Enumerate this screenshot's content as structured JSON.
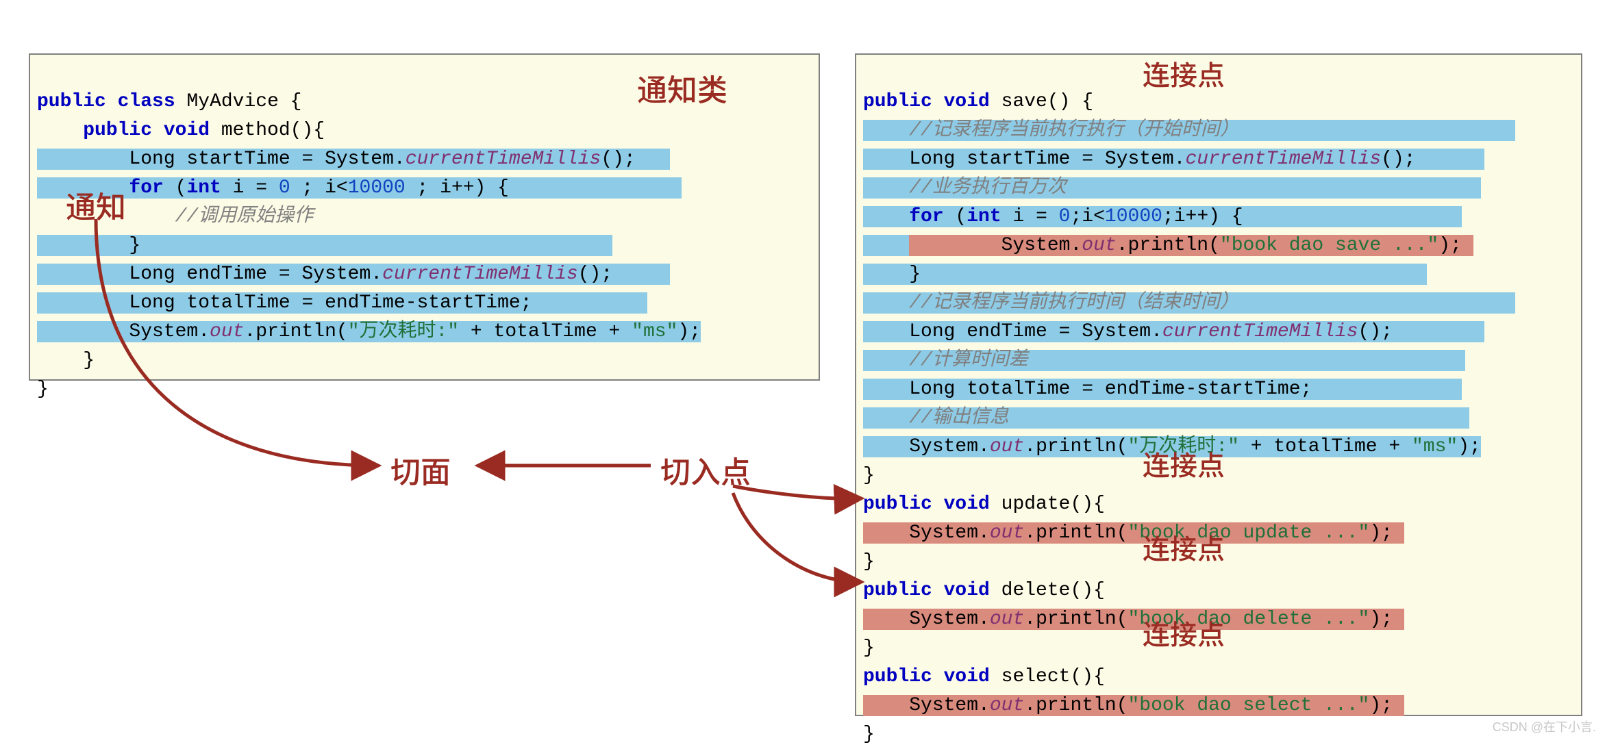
{
  "labels": {
    "adviceClass": "通知类",
    "advice": "通知",
    "aspect": "切面",
    "pointcut": "切入点",
    "joinPoint1": "连接点",
    "joinPoint2": "连接点",
    "joinPoint3": "连接点",
    "joinPoint4": "连接点"
  },
  "left": {
    "l1a": "public",
    "l1b": " class",
    "l1c": " MyAdvice {",
    "l2a": "    public",
    "l2b": " void",
    "l2c": " method(){",
    "l3a": "        Long startTime = System.",
    "l3b": "currentTimeMillis",
    "l3c": "();",
    "l4a": "        for",
    "l4b": " (",
    "l4c": "int",
    "l4d": " i = ",
    "l4e": "0",
    "l4f": " ; i<",
    "l4g": "10000",
    "l4h": " ; i++) {",
    "l5a": "            //调用原始操作",
    "l6a": "        }",
    "l7a": "        Long endTime = System.",
    "l7b": "currentTimeMillis",
    "l7c": "();",
    "l8a": "        Long totalTime = endTime-startTime;",
    "l9a": "        System.",
    "l9b": "out",
    "l9c": ".println(",
    "l9d": "\"万次耗时:\"",
    "l9e": " + totalTime + ",
    "l9f": "\"ms\"",
    "l9g": ");",
    "l10": "    }",
    "l11": "}"
  },
  "right": {
    "r1a": "public",
    "r1b": " void",
    "r1c": " save() {",
    "r2": "    //记录程序当前执行执行（开始时间）",
    "r3a": "    Long startTime = System.",
    "r3b": "currentTimeMillis",
    "r3c": "();",
    "r4": "    //业务执行百万次",
    "r5a": "    for",
    "r5b": " (",
    "r5c": "int",
    "r5d": " i = ",
    "r5e": "0",
    "r5f": ";i<",
    "r5g": "10000",
    "r5h": ";i++) {",
    "r6a": "        System.",
    "r6b": "out",
    "r6c": ".println(",
    "r6d": "\"book dao save ...\"",
    "r6e": ");",
    "r7": "    }",
    "r8": "    //记录程序当前执行时间（结束时间）",
    "r9a": "    Long endTime = System.",
    "r9b": "currentTimeMillis",
    "r9c": "();",
    "r10": "    //计算时间差",
    "r11": "    Long totalTime = endTime-startTime;",
    "r12": "    //输出信息",
    "r13a": "    System.",
    "r13b": "out",
    "r13c": ".println(",
    "r13d": "\"万次耗时:\"",
    "r13e": " + totalTime + ",
    "r13f": "\"ms\"",
    "r13g": ");",
    "r14": "}",
    "u1a": "public",
    "u1b": " void",
    "u1c": " update(){",
    "u2a": "    System.",
    "u2b": "out",
    "u2c": ".println(",
    "u2d": "\"book dao update ...\"",
    "u2e": ");",
    "u3": "}",
    "d1a": "public",
    "d1b": " void",
    "d1c": " delete(){",
    "d2a": "    System.",
    "d2b": "out",
    "d2c": ".println(",
    "d2d": "\"book dao delete ...\"",
    "d2e": ");",
    "d3": "}",
    "s1a": "public",
    "s1b": " void",
    "s1c": " select(){",
    "s2a": "    System.",
    "s2b": "out",
    "s2c": ".println(",
    "s2d": "\"book dao select ...\"",
    "s2e": ");",
    "s3": "}"
  },
  "watermark": "CSDN @在下小言."
}
